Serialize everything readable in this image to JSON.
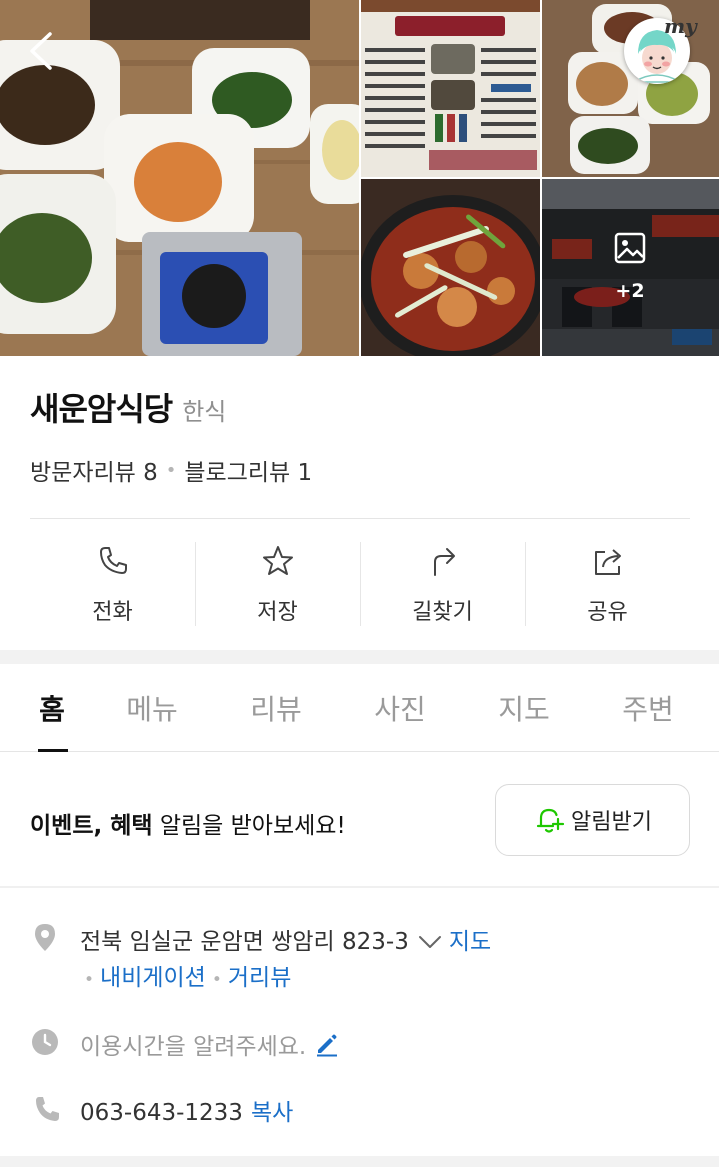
{
  "header": {
    "more_photos_count": "+2",
    "my_badge": "my"
  },
  "place": {
    "name": "새운암식당",
    "category": "한식"
  },
  "reviews": {
    "visitor_label": "방문자리뷰 8",
    "blog_label": "블로그리뷰 1"
  },
  "actions": [
    {
      "label": "전화",
      "icon": "phone-icon"
    },
    {
      "label": "저장",
      "icon": "star-icon"
    },
    {
      "label": "길찾기",
      "icon": "directions-icon"
    },
    {
      "label": "공유",
      "icon": "share-icon"
    }
  ],
  "tabs": [
    {
      "label": "홈",
      "active": true
    },
    {
      "label": "메뉴",
      "active": false
    },
    {
      "label": "리뷰",
      "active": false
    },
    {
      "label": "사진",
      "active": false
    },
    {
      "label": "지도",
      "active": false
    },
    {
      "label": "주변",
      "active": false
    }
  ],
  "alert": {
    "text_bold": "이벤트, 혜택",
    "text_rest": " 알림을 받아보세요!",
    "button_label": "알림받기"
  },
  "info": {
    "address": "전북 임실군 운암면 쌍암리 823-3",
    "map_link": "지도",
    "navigation_link": "내비게이션",
    "streetview_link": "거리뷰",
    "hours_placeholder": "이용시간을 알려주세요.",
    "phone": "063-643-1233",
    "copy_link": "복사"
  },
  "colors": {
    "link": "#1b6fc8",
    "bell_green": "#1ec800",
    "muted": "#9a9a9a"
  }
}
